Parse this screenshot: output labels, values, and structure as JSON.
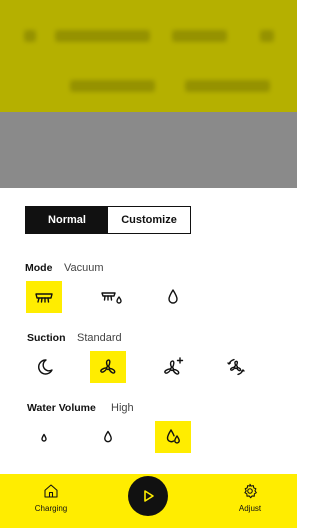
{
  "mode_toggle": {
    "normal_label": "Normal",
    "customize_label": "Customize",
    "selected": "Normal"
  },
  "mode": {
    "title": "Mode",
    "value": "Vacuum",
    "options": [
      {
        "icon": "brush-icon",
        "selected": true
      },
      {
        "icon": "brush-water-icon",
        "selected": false
      },
      {
        "icon": "water-drop-icon",
        "selected": false
      }
    ]
  },
  "suction": {
    "title": "Suction",
    "value": "Standard",
    "options": [
      {
        "icon": "moon-icon",
        "selected": false
      },
      {
        "icon": "fan-icon",
        "selected": true
      },
      {
        "icon": "fan-plus-icon",
        "selected": false
      },
      {
        "icon": "fan-max-icon",
        "selected": false
      }
    ]
  },
  "water_volume": {
    "title": "Water Volume",
    "value": "High",
    "options": [
      {
        "icon": "drop-small-icon",
        "selected": false
      },
      {
        "icon": "drop-medium-icon",
        "selected": false
      },
      {
        "icon": "drop-large-icon",
        "selected": true
      }
    ]
  },
  "bottom_bar": {
    "charging_label": "Charging",
    "adjust_label": "Adjust",
    "play_icon": "play-icon",
    "accent": "#ffed00"
  }
}
